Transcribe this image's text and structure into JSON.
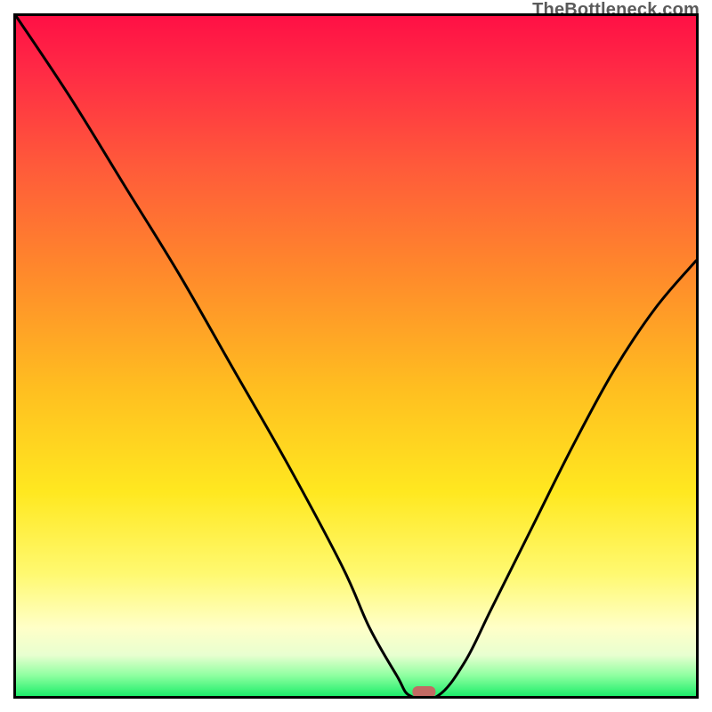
{
  "watermark": {
    "text": "TheBottleneck.com"
  },
  "chart_data": {
    "type": "line",
    "title": "",
    "xlabel": "",
    "ylabel": "",
    "xlim": [
      0,
      100
    ],
    "ylim": [
      0,
      100
    ],
    "grid": false,
    "legend": false,
    "series": [
      {
        "name": "bottleneck-curve",
        "x": [
          0,
          8,
          16,
          24,
          32,
          40,
          48,
          52,
          56,
          58,
          62,
          66,
          70,
          76,
          82,
          88,
          94,
          100
        ],
        "values": [
          100,
          88,
          75,
          62,
          48,
          34,
          19,
          10,
          3,
          0,
          0,
          5,
          13,
          25,
          37,
          48,
          57,
          64
        ]
      }
    ],
    "marker": {
      "x": 60,
      "y": 0,
      "shape": "pill",
      "color": "#c26a63"
    },
    "background_gradient": {
      "direction": "vertical",
      "stops": [
        {
          "pos": 0.0,
          "color": "#ff1045"
        },
        {
          "pos": 0.08,
          "color": "#ff2a45"
        },
        {
          "pos": 0.22,
          "color": "#ff5a3a"
        },
        {
          "pos": 0.38,
          "color": "#ff8a2b"
        },
        {
          "pos": 0.55,
          "color": "#ffbf20"
        },
        {
          "pos": 0.7,
          "color": "#ffe820"
        },
        {
          "pos": 0.82,
          "color": "#fff970"
        },
        {
          "pos": 0.9,
          "color": "#ffffc8"
        },
        {
          "pos": 0.94,
          "color": "#e8ffd0"
        },
        {
          "pos": 0.97,
          "color": "#8effa0"
        },
        {
          "pos": 1.0,
          "color": "#1eee6b"
        }
      ]
    }
  }
}
